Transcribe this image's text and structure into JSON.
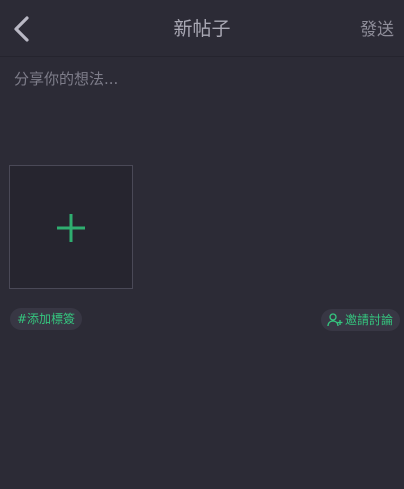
{
  "header": {
    "title": "新帖子",
    "send_label": "發送",
    "back_icon": "chevron-left-icon"
  },
  "editor": {
    "placeholder": "分享你的想法...",
    "value": ""
  },
  "media": {
    "add_icon": "plus-icon"
  },
  "chips": {
    "tag_label": "#添加標簽",
    "invite_label": "邀請討論",
    "invite_icon": "add-person-icon"
  },
  "colors": {
    "background": "#2c2b36",
    "accent": "#35c67f",
    "chip_bg": "#383744",
    "muted_text": "#8e8d99"
  }
}
